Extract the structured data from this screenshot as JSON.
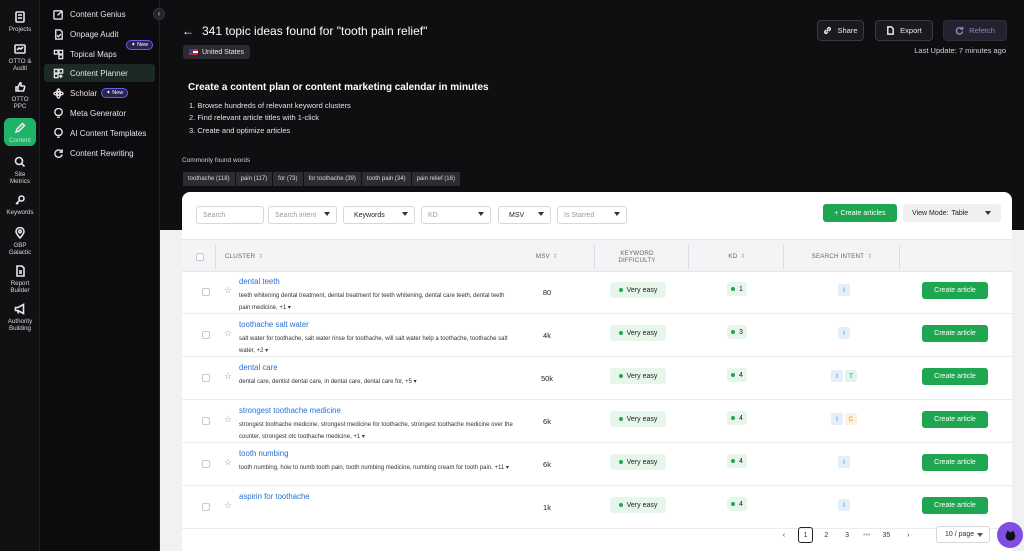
{
  "rail": [
    {
      "label": "Projects",
      "icon": "projects-icon"
    },
    {
      "label": "OTTO & Audit",
      "icon": "otto-icon"
    },
    {
      "label": "OTTO PPC",
      "icon": "ppc-icon"
    },
    {
      "label": "Content",
      "icon": "pencil-icon"
    },
    {
      "label": "Site Metrics",
      "icon": "metrics-icon"
    },
    {
      "label": "Keywords",
      "icon": "key-icon"
    },
    {
      "label": "GBP Galactic",
      "icon": "pin-icon"
    },
    {
      "label": "Report Builder",
      "icon": "report-icon"
    },
    {
      "label": "Authority Building",
      "icon": "megaphone-icon"
    }
  ],
  "subnav": [
    {
      "label": "Content Genius"
    },
    {
      "label": "Onpage Audit"
    },
    {
      "label": "Topical Maps",
      "badge": "✦ New"
    },
    {
      "label": "Content Planner"
    },
    {
      "label": "Scholar",
      "badge": "✦ New"
    },
    {
      "label": "Meta Generator"
    },
    {
      "label": "AI Content Templates"
    },
    {
      "label": "Content Rewriting"
    }
  ],
  "header": {
    "title": "341 topic ideas found for \"tooth pain relief\"",
    "country": "United States",
    "share": "Share",
    "export": "Export",
    "refetch": "Refetch",
    "last_update": "Last Update: 7 minutes ago"
  },
  "intro": {
    "title": "Create a content plan or content marketing calendar in minutes",
    "steps": [
      "1.  Browse hundreds of relevant keyword clusters",
      "2.  Find relevant article titles with 1-click",
      "3.  Create and optimize articles"
    ]
  },
  "common_words": {
    "label": "Commonly found words",
    "chips": [
      "toothache (118)",
      "pain (117)",
      "for (73)",
      "for toothache (39)",
      "tooth pain (34)",
      "pain relief (16)"
    ]
  },
  "filters": {
    "search": "Search",
    "intent": "Search intent",
    "keywords": "Keywords",
    "kd": "KD",
    "msv": "MSV",
    "starred": "Is Starred",
    "create_articles": "+ Create articles",
    "view_mode_label": "View Mode:",
    "view_mode_value": "Table"
  },
  "columns": {
    "cluster": "CLUSTER",
    "msv": "MSV",
    "difficulty": "KEYWORD DIFFICULTY",
    "kd": "KD",
    "intent": "SEARCH INTENT"
  },
  "rows": [
    {
      "title": "dental teeth",
      "keywords": "teeth whitening dental treatment, dental treatment for teeth whitening, dental care teeth, dental teeth pain medicine, +1 ▾",
      "msv": "80",
      "difficulty": "Very easy",
      "kd": "1",
      "intents": [
        "I"
      ],
      "action": "Create article"
    },
    {
      "title": "toothache salt water",
      "keywords": "salt water for toothache, salt water rinse for toothache, will salt water help a toothache, toothache salt water, +2 ▾",
      "msv": "4k",
      "difficulty": "Very easy",
      "kd": "3",
      "intents": [
        "I"
      ],
      "action": "Create article"
    },
    {
      "title": "dental care",
      "keywords": "dental care, dentist dental care, in dental care, dental care for, +5 ▾",
      "msv": "50k",
      "difficulty": "Very easy",
      "kd": "4",
      "intents": [
        "I",
        "T"
      ],
      "action": "Create article"
    },
    {
      "title": "strongest toothache medicine",
      "keywords": "strongest toothache medicine, strongest medicine for toothache, strongest toothache medicine over the counter, strongest otc toothache medicine, +1 ▾",
      "msv": "6k",
      "difficulty": "Very easy",
      "kd": "4",
      "intents": [
        "I",
        "C"
      ],
      "action": "Create article"
    },
    {
      "title": "tooth numbing",
      "keywords": "tooth numbing, how to numb tooth pain, tooth numbing medicine, numbing cream for tooth pain, +11 ▾",
      "msv": "6k",
      "difficulty": "Very easy",
      "kd": "4",
      "intents": [
        "I"
      ],
      "action": "Create article"
    },
    {
      "title": "aspirin for toothache",
      "keywords": "",
      "msv": "1k",
      "difficulty": "Very easy",
      "kd": "4",
      "intents": [
        "I"
      ],
      "action": "Create article"
    }
  ],
  "pagination": {
    "prev": "‹",
    "pages": [
      "1",
      "2",
      "3"
    ],
    "ellipsis": "•••",
    "last": "35",
    "next": "›",
    "per_page": "10 / page"
  },
  "colors": {
    "accent": "#1fa650",
    "link": "#2a6fd6",
    "refetch": "#8d86c7",
    "badge": "#6b5cf0"
  }
}
